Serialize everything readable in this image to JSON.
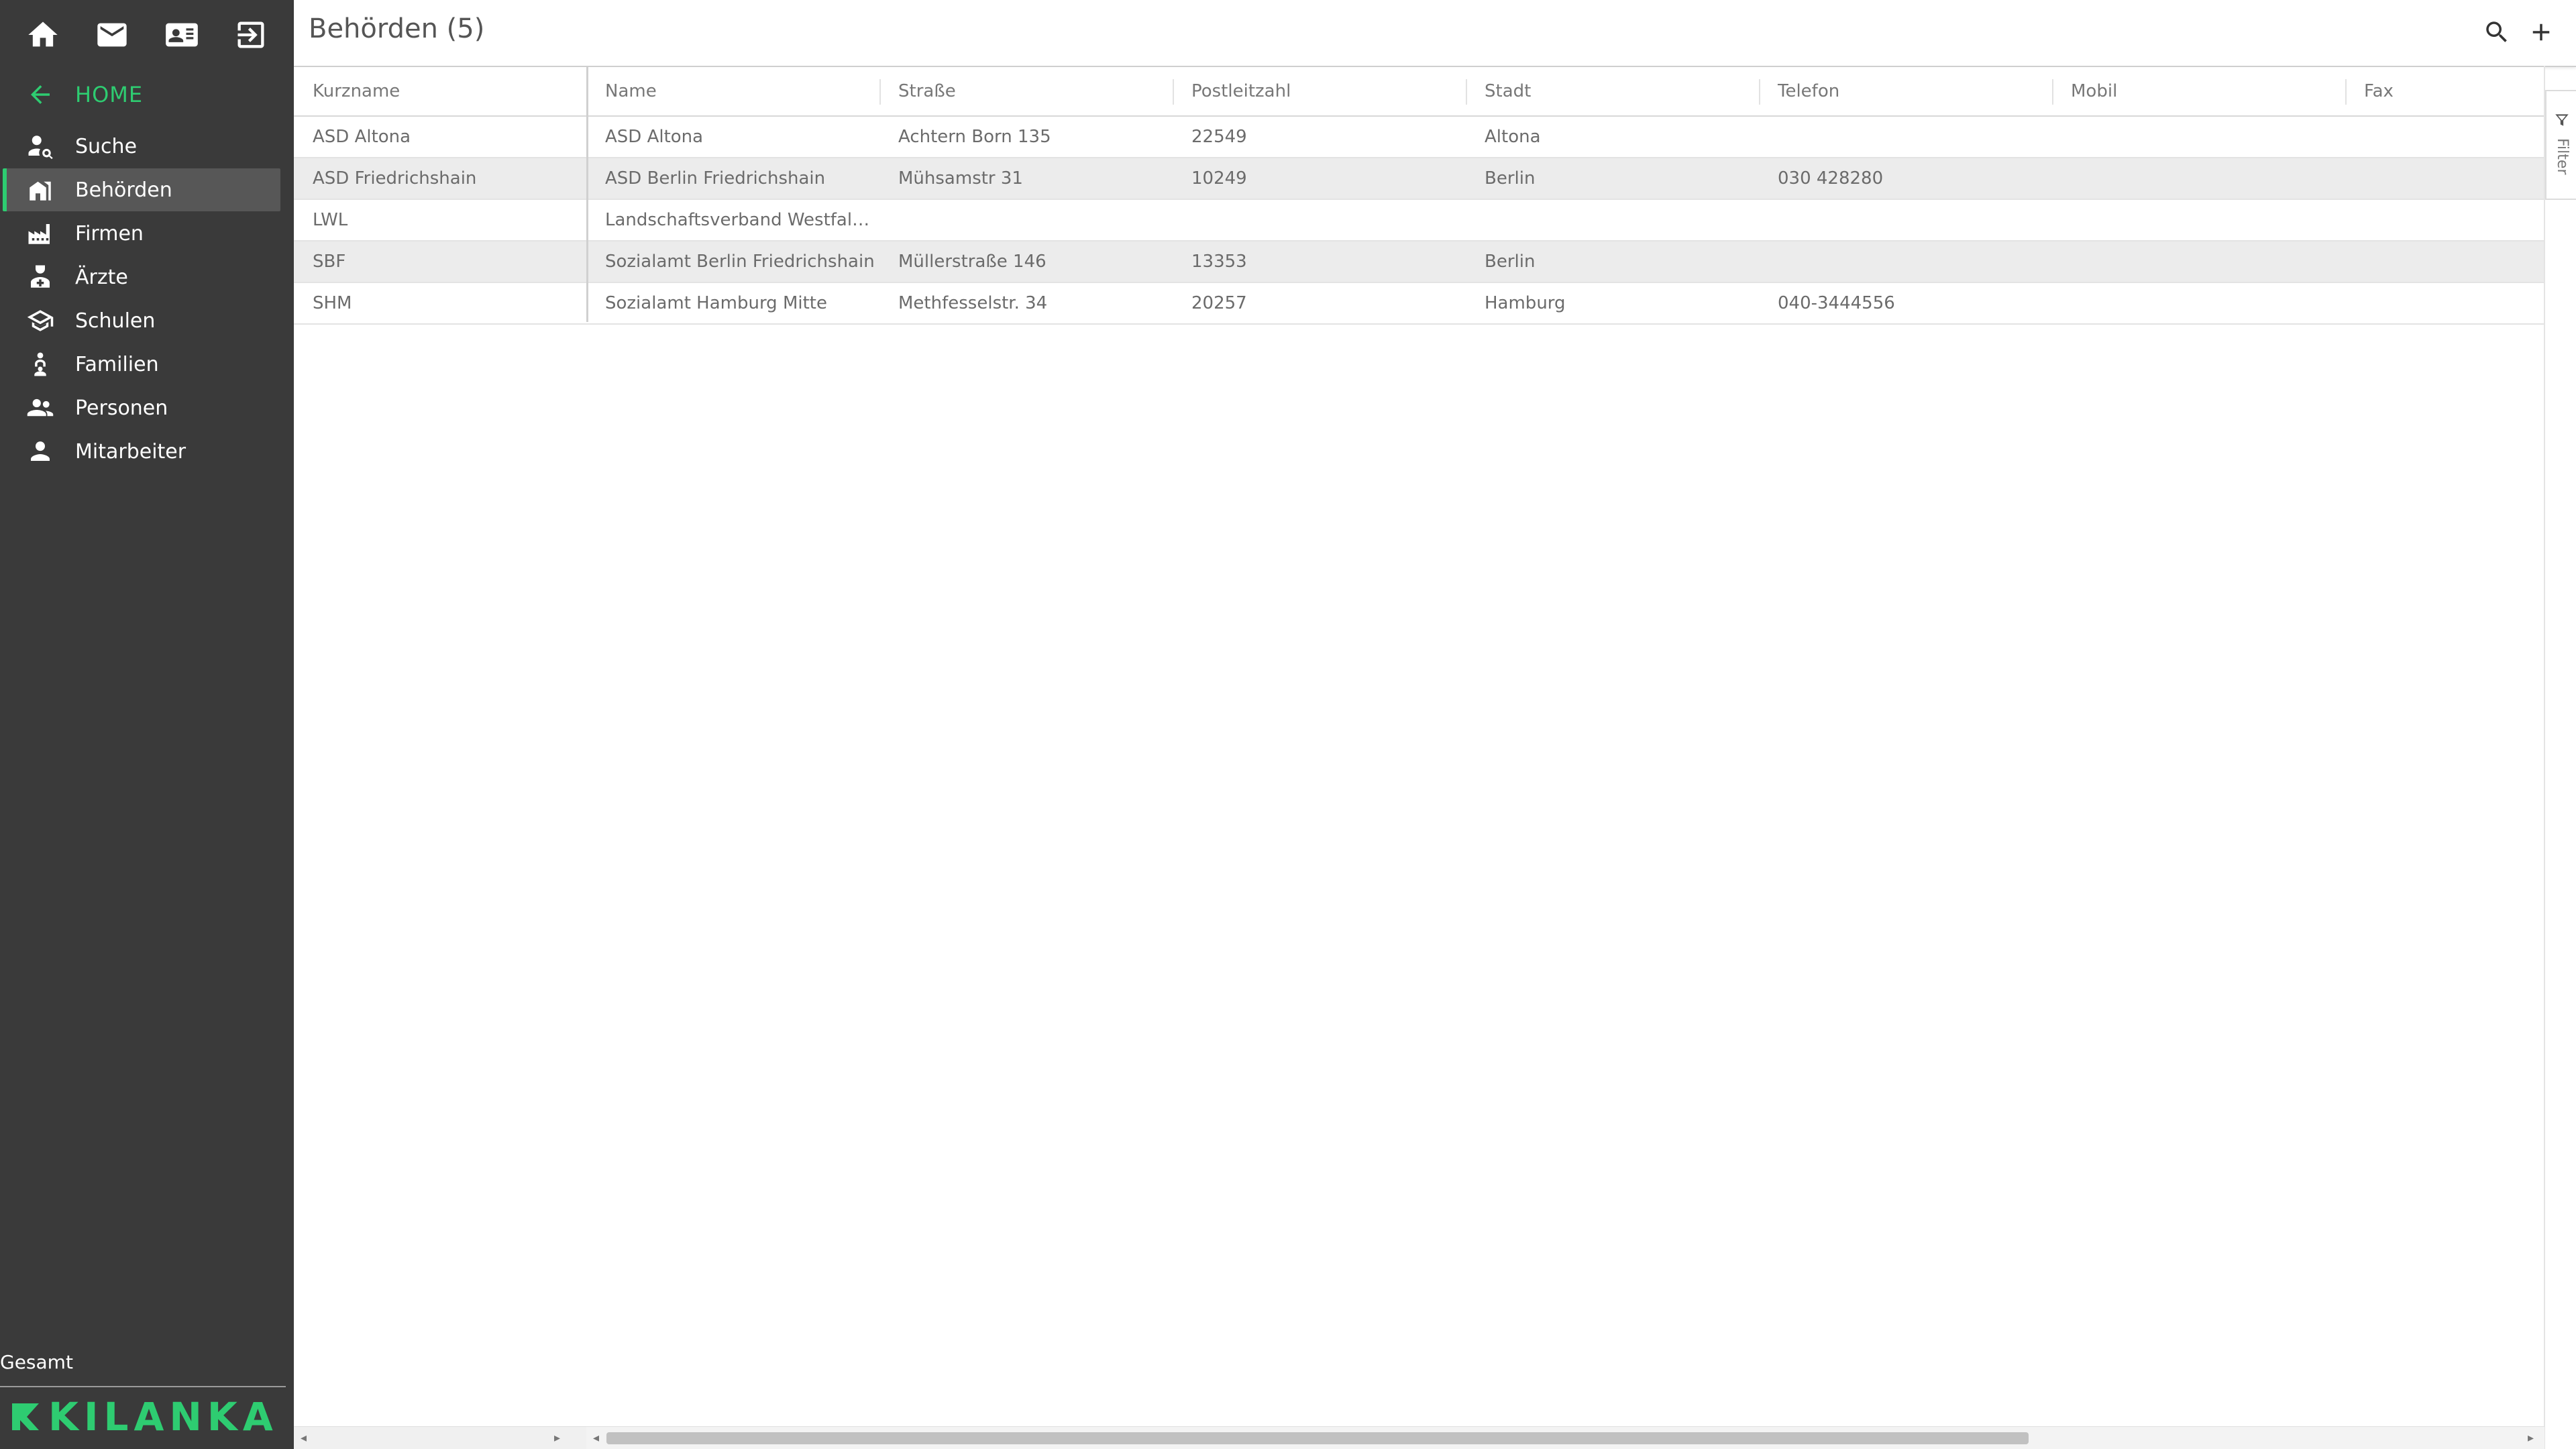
{
  "header": {
    "title": "Behörden (5)"
  },
  "sidebar": {
    "home_label": "HOME",
    "items": [
      {
        "label": "Suche",
        "icon": "person-search-icon"
      },
      {
        "label": "Behörden",
        "icon": "building-icon",
        "active": true
      },
      {
        "label": "Firmen",
        "icon": "factory-icon"
      },
      {
        "label": "Ärzte",
        "icon": "doctor-icon"
      },
      {
        "label": "Schulen",
        "icon": "school-icon"
      },
      {
        "label": "Familien",
        "icon": "family-icon"
      },
      {
        "label": "Personen",
        "icon": "people-icon"
      },
      {
        "label": "Mitarbeiter",
        "icon": "person-icon"
      }
    ],
    "footer_label": "Gesamt",
    "brand": "KILANKA"
  },
  "table": {
    "columns": [
      "Kurzname",
      "Name",
      "Straße",
      "Postleitzahl",
      "Stadt",
      "Telefon",
      "Mobil",
      "Fax"
    ],
    "rows": [
      [
        "ASD Altona",
        "ASD Altona",
        "Achtern Born 135",
        "22549",
        "Altona",
        "",
        "",
        ""
      ],
      [
        "ASD Friedrichshain",
        "ASD Berlin Friedrichshain",
        "Mühsamstr 31",
        "10249",
        "Berlin",
        "030 428280",
        "",
        ""
      ],
      [
        "LWL",
        "Landschaftsverband Westfalen-...",
        "",
        "",
        "",
        "",
        "",
        ""
      ],
      [
        "SBF",
        "Sozialamt Berlin Friedrichshain",
        "Müllerstraße 146",
        "13353",
        "Berlin",
        "",
        "",
        ""
      ],
      [
        "SHM",
        "Sozialamt Hamburg Mitte",
        "Methfesselstr. 34",
        "20257",
        "Hamburg",
        "040-3444556",
        "",
        ""
      ]
    ]
  },
  "filter": {
    "label": "Filter"
  },
  "colors": {
    "accent": "#2ecc71",
    "sidebar_bg": "#3a3a3a"
  }
}
